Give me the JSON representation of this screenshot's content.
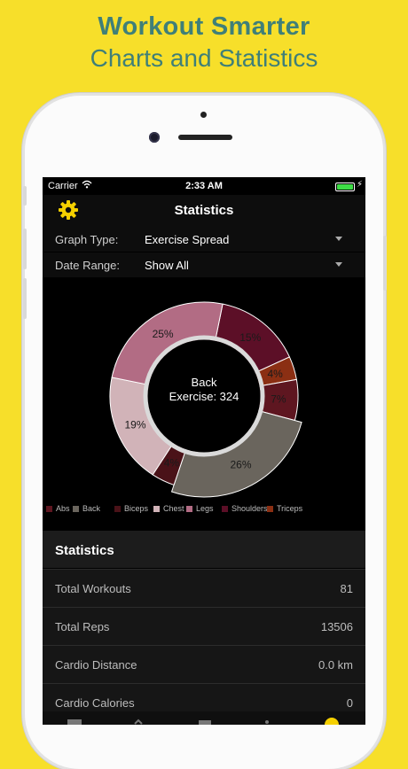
{
  "promo": {
    "line1": "Workout Smarter",
    "line2": "Charts and Statistics"
  },
  "status_bar": {
    "carrier": "Carrier",
    "time": "2:33 AM",
    "battery_level": 1.0
  },
  "nav": {
    "title": "Statistics",
    "settings_icon": "gear-icon"
  },
  "filters": {
    "graph_type": {
      "label": "Graph Type:",
      "value": "Exercise Spread"
    },
    "date_range": {
      "label": "Date Range:",
      "value": "Show All"
    }
  },
  "chart_data": {
    "type": "pie",
    "style": "donut",
    "center_label_line1": "Back",
    "center_label_line2": "Exercise: 324",
    "selected_slice": "Back",
    "slices": [
      {
        "name": "Shoulders",
        "percent": 15,
        "label": "15%",
        "color": "#5c0f27"
      },
      {
        "name": "Triceps",
        "percent": 4,
        "label": "4%",
        "color": "#8b2f13"
      },
      {
        "name": "Abs",
        "percent": 7,
        "label": "7%",
        "color": "#5e1620"
      },
      {
        "name": "Back",
        "percent": 26,
        "label": "26%",
        "color": "#6a655d"
      },
      {
        "name": "Biceps",
        "percent": 4,
        "label": "4%",
        "color": "#4a1218"
      },
      {
        "name": "Chest",
        "percent": 19,
        "label": "19%",
        "color": "#d1b3b8"
      },
      {
        "name": "Legs",
        "percent": 25,
        "label": "25%",
        "color": "#b26c84"
      }
    ],
    "legend": [
      {
        "name": "Abs",
        "color": "#5e1620"
      },
      {
        "name": "Back",
        "color": "#6a655d"
      },
      {
        "name": "Biceps",
        "color": "#4a1218"
      },
      {
        "name": "Chest",
        "color": "#d1b3b8"
      },
      {
        "name": "Legs",
        "color": "#b26c84"
      },
      {
        "name": "Shoulders",
        "color": "#5c0f27"
      },
      {
        "name": "Triceps",
        "color": "#8b2f13"
      }
    ]
  },
  "stats": {
    "header": "Statistics",
    "rows": [
      {
        "label": "Total Workouts",
        "value": "81"
      },
      {
        "label": "Total Reps",
        "value": "13506"
      },
      {
        "label": "Cardio Distance",
        "value": "0.0 km"
      },
      {
        "label": "Cardio Calories",
        "value": "0"
      }
    ]
  },
  "colors": {
    "background": "#f7df2a",
    "accent": "#f5d000",
    "promo_text": "#3f7f78"
  }
}
